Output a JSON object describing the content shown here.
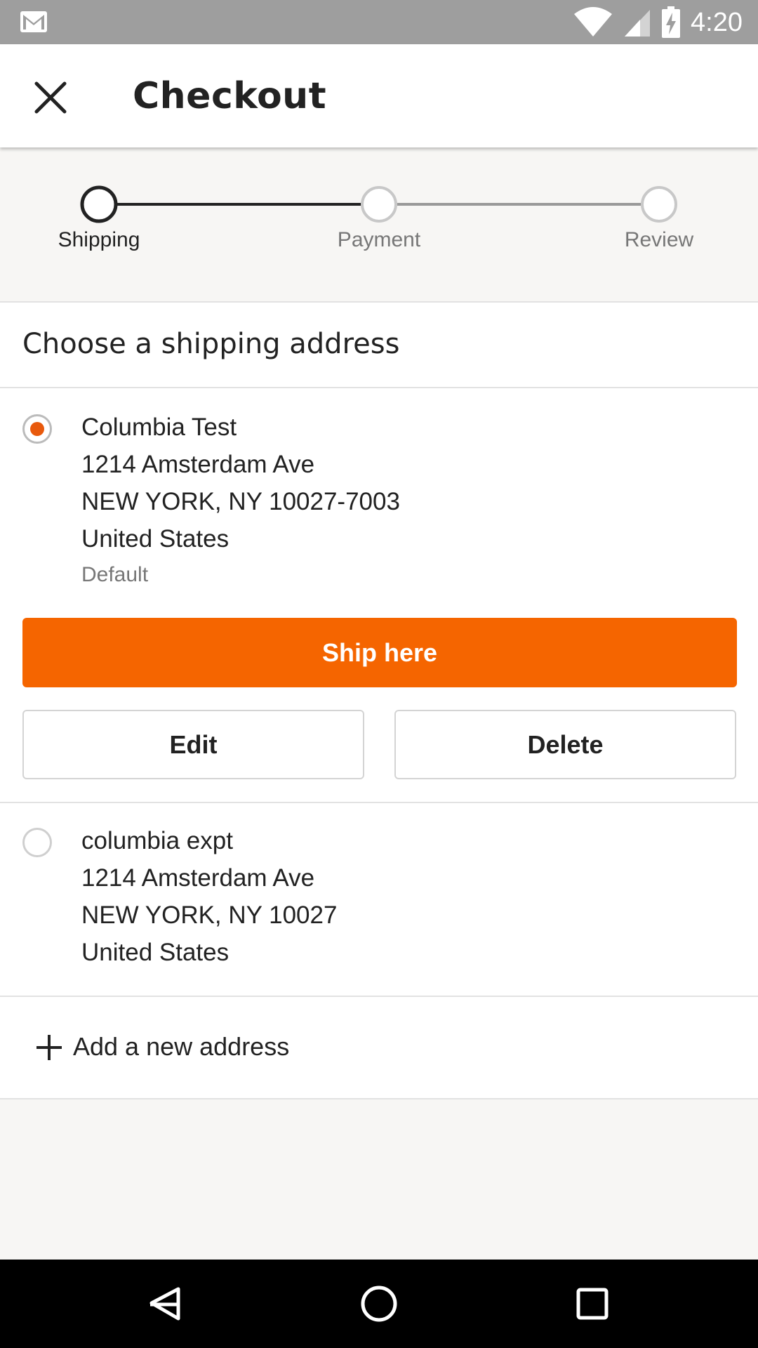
{
  "status_bar": {
    "time": "4:20",
    "icons": [
      "gmail-icon",
      "wifi-icon",
      "signal-icon",
      "battery-charging-icon"
    ]
  },
  "app_bar": {
    "title": "Checkout",
    "close_icon": "close-icon"
  },
  "stepper": {
    "steps": [
      {
        "label": "Shipping",
        "state": "active"
      },
      {
        "label": "Payment",
        "state": "inactive"
      },
      {
        "label": "Review",
        "state": "inactive"
      }
    ]
  },
  "section": {
    "title": "Choose a shipping address"
  },
  "addresses": [
    {
      "selected": true,
      "lines": [
        "Columbia Test",
        "1214 Amsterdam Ave",
        "NEW YORK, NY 10027-7003",
        "United States"
      ],
      "tag": "Default",
      "ship_label": "Ship here",
      "edit_label": "Edit",
      "delete_label": "Delete"
    },
    {
      "selected": false,
      "lines": [
        "columbia expt",
        "1214 Amsterdam Ave",
        "NEW YORK, NY 10027",
        "United States"
      ]
    }
  ],
  "add_new": {
    "label": "Add a new address",
    "icon": "plus-icon"
  },
  "colors": {
    "accent": "#f56500",
    "radio_dot": "#e8590c",
    "status_bar": "#9e9e9e",
    "background": "#f7f6f4"
  },
  "nav_bar": {
    "icons": [
      "back-icon",
      "home-icon",
      "recents-icon"
    ]
  }
}
